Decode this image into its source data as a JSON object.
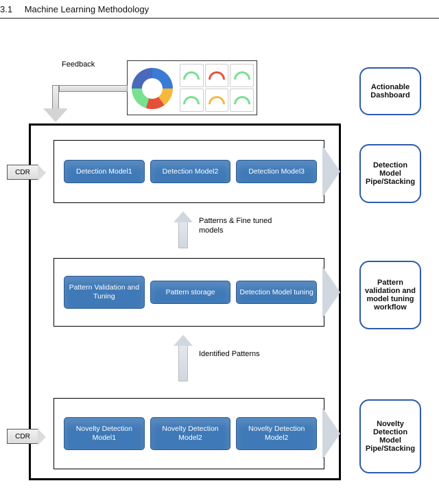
{
  "heading": {
    "number": "3.1",
    "title": "Machine Learning Methodology"
  },
  "feedback_label": "Feedback",
  "cdr_label": "CDR",
  "side_labels": {
    "dashboard": "Actionable Dashboard",
    "detection": "Detection Model Pipe/Stacking",
    "pattern": "Pattern validation and model tuning workflow",
    "novelty": "Novelty Detection Model Pipe/Stacking"
  },
  "rows": {
    "detection": [
      "Detection Model1",
      "Detection Model2",
      "Detection Model3"
    ],
    "pattern": [
      "Pattern Validation and Tuning",
      "Pattern storage",
      "Detection Model tuning"
    ],
    "novelty": [
      "Novelty Detection Model1",
      "Novelty Detection Model2",
      "Novelty Detection Model2"
    ]
  },
  "connectors": {
    "patterns_fine": "Patterns & Fine tuned models",
    "identified": "Identified Patterns"
  },
  "colors": {
    "node_fill": "#3f79b7",
    "side_border": "#2e5aac"
  }
}
